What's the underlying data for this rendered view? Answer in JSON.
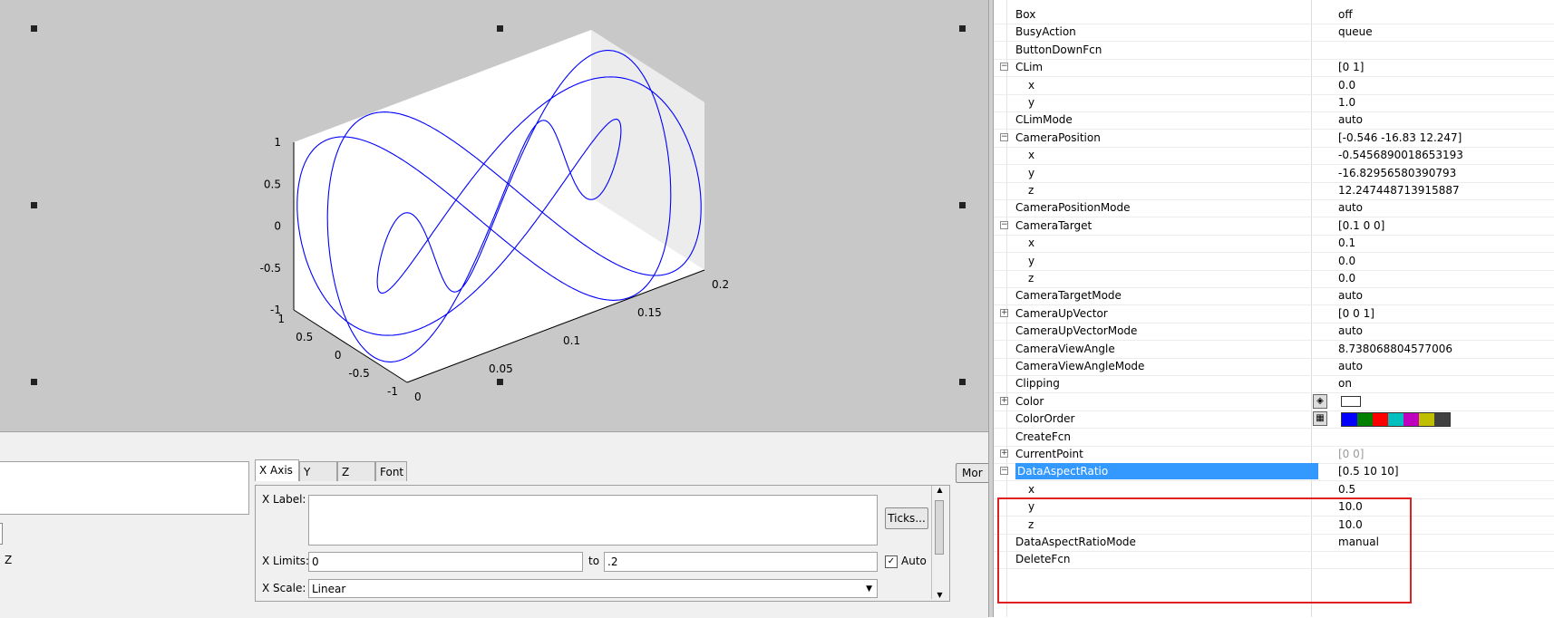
{
  "axes": {
    "z_ticks": [
      "1",
      "0.5",
      "0",
      "-0.5",
      "-1"
    ],
    "y_ticks": [
      "1",
      "0.5",
      "0",
      "-0.5",
      "-1"
    ],
    "x_ticks": [
      "0",
      "0.05",
      "0.1",
      "0.15",
      "0.2"
    ],
    "line_color": "#0000ff"
  },
  "editor": {
    "tabs": [
      "X Axis",
      "Y Axis",
      "Z Axis",
      "Font"
    ],
    "z_label": "Z",
    "x_label_caption": "X Label:",
    "ticks_button": "Ticks...",
    "x_limits_caption": "X Limits:",
    "x_limit_min": "0",
    "to_caption": "to",
    "x_limit_max": ".2",
    "auto_label": "Auto",
    "auto_checked": "✓",
    "x_scale_caption": "X Scale:",
    "x_scale_value": "Linear",
    "more_button": "Mor"
  },
  "inspector": {
    "rows": [
      {
        "name": "Box",
        "value": "off",
        "indent": 0
      },
      {
        "name": "BusyAction",
        "value": "queue",
        "indent": 0
      },
      {
        "name": "ButtonDownFcn",
        "value": "",
        "indent": 0
      },
      {
        "name": "CLim",
        "value": "[0 1]",
        "indent": 0,
        "expander": "−"
      },
      {
        "name": "x",
        "value": "0.0",
        "indent": 1
      },
      {
        "name": "y",
        "value": "1.0",
        "indent": 1
      },
      {
        "name": "CLimMode",
        "value": "auto",
        "indent": 0
      },
      {
        "name": "CameraPosition",
        "value": "[-0.546 -16.83 12.247]",
        "indent": 0,
        "expander": "−"
      },
      {
        "name": "x",
        "value": "-0.5456890018653193",
        "indent": 1
      },
      {
        "name": "y",
        "value": "-16.82956580390793",
        "indent": 1
      },
      {
        "name": "z",
        "value": "12.247448713915887",
        "indent": 1
      },
      {
        "name": "CameraPositionMode",
        "value": "auto",
        "indent": 0
      },
      {
        "name": "CameraTarget",
        "value": "[0.1 0 0]",
        "indent": 0,
        "expander": "−"
      },
      {
        "name": "x",
        "value": "0.1",
        "indent": 1
      },
      {
        "name": "y",
        "value": "0.0",
        "indent": 1
      },
      {
        "name": "z",
        "value": "0.0",
        "indent": 1
      },
      {
        "name": "CameraTargetMode",
        "value": "auto",
        "indent": 0
      },
      {
        "name": "CameraUpVector",
        "value": "[0 0 1]",
        "indent": 0,
        "expander": "+"
      },
      {
        "name": "CameraUpVectorMode",
        "value": "auto",
        "indent": 0
      },
      {
        "name": "CameraViewAngle",
        "value": "8.738068804577006",
        "indent": 0
      },
      {
        "name": "CameraViewAngleMode",
        "value": "auto",
        "indent": 0
      },
      {
        "name": "Clipping",
        "value": "on",
        "indent": 0
      },
      {
        "name": "Color",
        "value": "",
        "indent": 0,
        "expander": "+",
        "special": "color"
      },
      {
        "name": "ColorOrder",
        "value": "",
        "indent": 0,
        "special": "colororder"
      },
      {
        "name": "CreateFcn",
        "value": "",
        "indent": 0
      },
      {
        "name": "CurrentPoint",
        "value": "[0 0]",
        "indent": 0,
        "expander": "+",
        "gray": true
      },
      {
        "name": "DataAspectRatio",
        "value": "[0.5 10 10]",
        "indent": 0,
        "expander": "−",
        "selected": true
      },
      {
        "name": "x",
        "value": "0.5",
        "indent": 1
      },
      {
        "name": "y",
        "value": "10.0",
        "indent": 1
      },
      {
        "name": "z",
        "value": "10.0",
        "indent": 1
      },
      {
        "name": "DataAspectRatioMode",
        "value": "manual",
        "indent": 0
      },
      {
        "name": "DeleteFcn",
        "value": "",
        "indent": 0
      }
    ],
    "color_order": [
      "#0000ff",
      "#008000",
      "#ff0000",
      "#00bfbf",
      "#bf00bf",
      "#bfbf00",
      "#404040"
    ],
    "highlight_color": "#e02020"
  }
}
